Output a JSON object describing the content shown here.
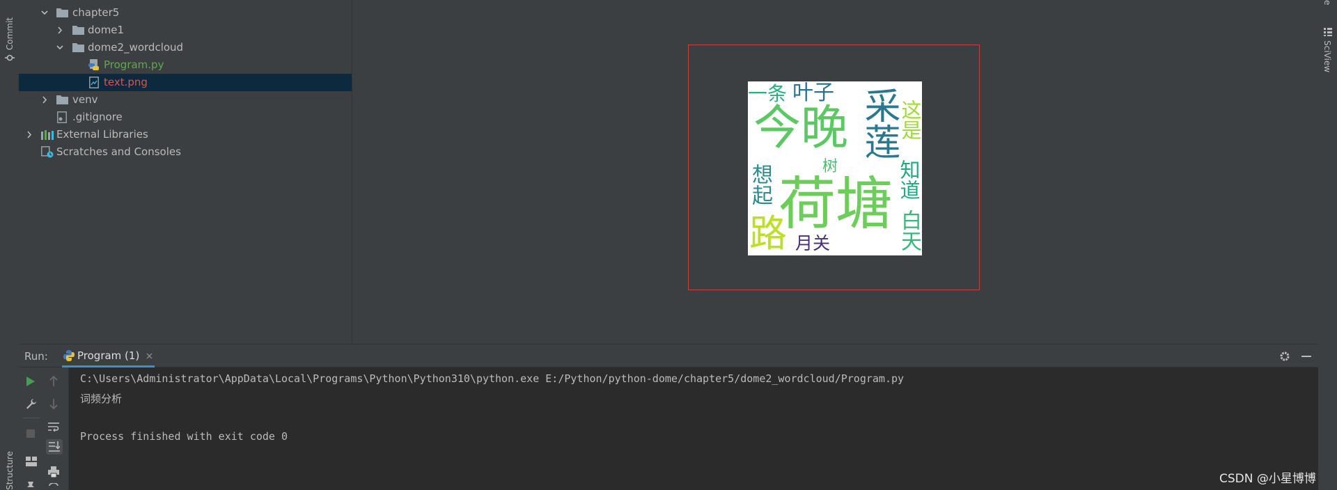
{
  "left_strip": {
    "commit_label": "Commit",
    "structure_label": "Structure"
  },
  "right_strip": {
    "sciview_label": "SciView",
    "top_label": "e"
  },
  "tree": {
    "items": [
      {
        "label": "chapter5",
        "type": "folder",
        "expanded": true
      },
      {
        "label": "dome1",
        "type": "folder",
        "expanded": false
      },
      {
        "label": "dome2_wordcloud",
        "type": "folder",
        "expanded": true
      },
      {
        "label": "Program.py",
        "type": "python-file",
        "color": "#62a754"
      },
      {
        "label": "text.png",
        "type": "image-file",
        "color": "#d3584f",
        "selected": true
      },
      {
        "label": "venv",
        "type": "folder",
        "expanded": false
      },
      {
        "label": ".gitignore",
        "type": "file"
      },
      {
        "label": "External Libraries",
        "type": "library",
        "expanded": false
      },
      {
        "label": "Scratches and Consoles",
        "type": "scratches"
      }
    ]
  },
  "image_viewer": {
    "words": [
      "今晚",
      "荷塘",
      "采莲",
      "一条",
      "叶子",
      "知道",
      "这是",
      "想起",
      "树",
      "路",
      "白天",
      "月关"
    ]
  },
  "run": {
    "label": "Run:",
    "tab_label": "Program (1)",
    "console_lines": [
      "C:\\Users\\Administrator\\AppData\\Local\\Programs\\Python\\Python310\\python.exe E:/Python/python-dome/chapter5/dome2_wordcloud/Program.py",
      "词频分析",
      "",
      "Process finished with exit code 0"
    ]
  },
  "watermark": "CSDN @小星博博",
  "colors": {
    "background": "#3c3f41",
    "console_bg": "#2b2b2b",
    "selection": "#0d293e",
    "frame_border": "#c9413b",
    "run_green": "#499c54"
  }
}
